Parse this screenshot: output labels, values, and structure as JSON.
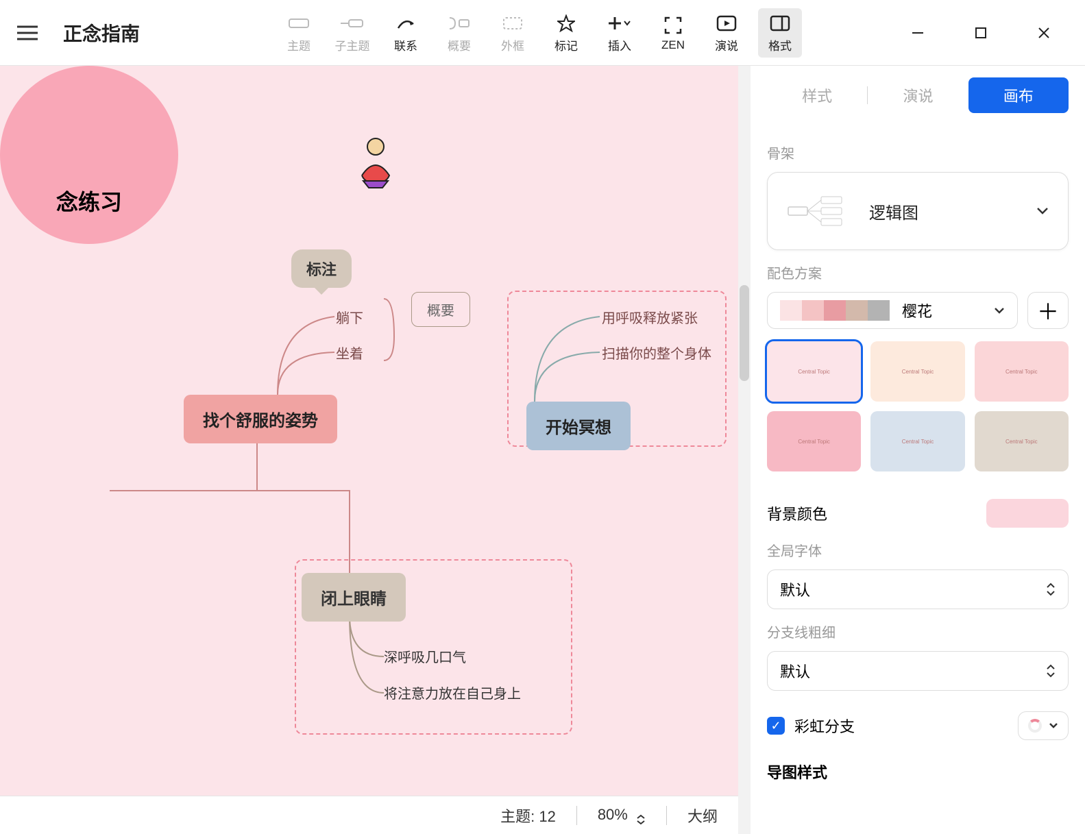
{
  "title": "正念指南",
  "toolbar": [
    {
      "id": "topic",
      "label": "主题",
      "enabled": false
    },
    {
      "id": "subtopic",
      "label": "子主题",
      "enabled": false
    },
    {
      "id": "relationship",
      "label": "联系",
      "enabled": true
    },
    {
      "id": "summary",
      "label": "概要",
      "enabled": false
    },
    {
      "id": "boundary",
      "label": "外框",
      "enabled": false
    },
    {
      "id": "marker",
      "label": "标记",
      "enabled": true
    },
    {
      "id": "insert",
      "label": "插入",
      "enabled": true
    },
    {
      "id": "zen",
      "label": "ZEN",
      "enabled": true
    },
    {
      "id": "pitch",
      "label": "演说",
      "enabled": true
    },
    {
      "id": "format",
      "label": "格式",
      "enabled": true,
      "active": true
    }
  ],
  "mindmap": {
    "central": "念练习",
    "posture": "找个舒服的姿势",
    "posture_children": [
      "躺下",
      "坐着"
    ],
    "callout": "标注",
    "summary_label": "概要",
    "eyes": "闭上眼睛",
    "eyes_children": [
      "深呼吸几口气",
      "将注意力放在自己身上"
    ],
    "meditate": "开始冥想",
    "meditate_children": [
      "用呼吸释放紧张",
      "扫描你的整个身体"
    ]
  },
  "statusbar": {
    "topic_label": "主题:",
    "topic_count": "12",
    "zoom": "80%",
    "outline": "大纲"
  },
  "panel": {
    "tabs": [
      "样式",
      "演说",
      "画布"
    ],
    "skeleton_label": "骨架",
    "skeleton_value": "逻辑图",
    "scheme_label": "配色方案",
    "scheme_value": "樱花",
    "bg_label": "背景颜色",
    "font_label": "全局字体",
    "font_value": "默认",
    "branch_label": "分支线粗细",
    "branch_value": "默认",
    "rainbow_label": "彩虹分支",
    "mapstyle_label": "导图样式",
    "theme_tiles": [
      "#fce4e9",
      "#fdeadd",
      "#fbd6d8",
      "#f7b9c4",
      "#d8e2ed",
      "#e1d9cf"
    ]
  }
}
